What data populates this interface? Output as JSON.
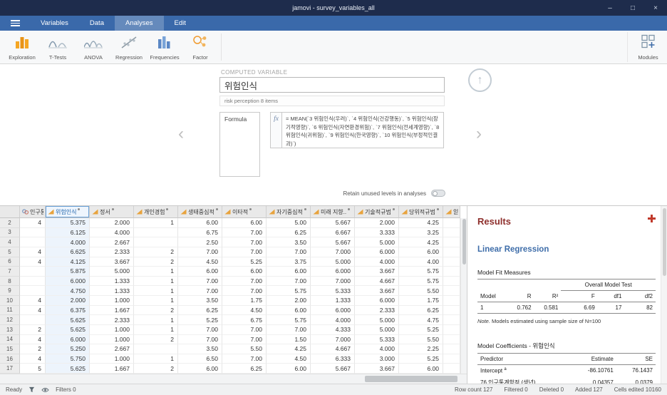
{
  "window": {
    "title": "jamovi - survey_variables_all"
  },
  "icons": {
    "minimize": "–",
    "maximize": "□",
    "close": "×",
    "chevron_left": "‹",
    "chevron_right": "›",
    "collapse_up": "↑"
  },
  "menu": {
    "tabs": [
      {
        "label": "Variables",
        "active": false
      },
      {
        "label": "Data",
        "active": false
      },
      {
        "label": "Analyses",
        "active": true
      },
      {
        "label": "Edit",
        "active": false
      }
    ]
  },
  "toolbar": {
    "items": [
      {
        "label": "Exploration"
      },
      {
        "label": "T-Tests"
      },
      {
        "label": "ANOVA"
      },
      {
        "label": "Regression"
      },
      {
        "label": "Frequencies"
      },
      {
        "label": "Factor"
      }
    ],
    "modules_label": "Modules"
  },
  "editor": {
    "panel_title": "COMPUTED VARIABLE",
    "name_value": "위험인식",
    "description": "risk perception 8  items",
    "formula_label": "Formula",
    "fx_label": "fx",
    "formula_text": "= MEAN(`3 위험인식(우려)`, `4 위험인식(건강행동)`, `5 위험인식(장기적영향)`, `6 위험인식(자연환경위험)`, `7 위험인식(전세계영향)`, `8 위험인식(귀위험)`, `9 위험인식(한국영향)`, `10 위험인식(부정적인결과)`)",
    "retain_label": "Retain unused levels in analyses",
    "retain_on": false
  },
  "table": {
    "selected_column_index": 1,
    "columns": [
      {
        "label": "인구통..",
        "icon": "nominal-variable-icon",
        "type": "nominal",
        "computed": false
      },
      {
        "label": "위험인식",
        "icon": "continuous-variable-icon",
        "type": "continuous",
        "computed": true
      },
      {
        "label": "정서",
        "icon": "continuous-variable-icon",
        "type": "continuous",
        "computed": true
      },
      {
        "label": "개인경험",
        "icon": "continuous-variable-icon",
        "type": "continuous",
        "computed": true
      },
      {
        "label": "생태중심적",
        "icon": "continuous-variable-icon",
        "type": "continuous",
        "computed": true
      },
      {
        "label": "이타적",
        "icon": "continuous-variable-icon",
        "type": "continuous",
        "computed": true
      },
      {
        "label": "자기중심적",
        "icon": "continuous-variable-icon",
        "type": "continuous",
        "computed": true
      },
      {
        "label": "미래 지향..",
        "icon": "continuous-variable-icon",
        "type": "continuous",
        "computed": true
      },
      {
        "label": "기술적규범",
        "icon": "continuous-variable-icon",
        "type": "continuous",
        "computed": true
      },
      {
        "label": "당위적규범",
        "icon": "continuous-variable-icon",
        "type": "continuous",
        "computed": true
      },
      {
        "label": "읻",
        "icon": "continuous-variable-icon",
        "type": "continuous",
        "computed": false
      }
    ],
    "rows": [
      {
        "num": "2",
        "cells": [
          "4",
          "5.375",
          "2.000",
          "1",
          "6.00",
          "6.00",
          "5.00",
          "5.667",
          "2.000",
          "4.25",
          ""
        ]
      },
      {
        "num": "3",
        "cells": [
          "",
          "6.125",
          "4.000",
          "",
          "6.75",
          "7.00",
          "6.25",
          "6.667",
          "3.333",
          "3.25",
          ""
        ]
      },
      {
        "num": "4",
        "cells": [
          "",
          "4.000",
          "2.667",
          "",
          "2.50",
          "7.00",
          "3.50",
          "5.667",
          "5.000",
          "4.25",
          ""
        ]
      },
      {
        "num": "5",
        "cells": [
          "4",
          "6.625",
          "2.333",
          "2",
          "7.00",
          "7.00",
          "7.00",
          "7.000",
          "6.000",
          "6.00",
          ""
        ]
      },
      {
        "num": "6",
        "cells": [
          "4",
          "4.125",
          "3.667",
          "2",
          "4.50",
          "5.25",
          "3.75",
          "5.000",
          "4.000",
          "4.00",
          ""
        ]
      },
      {
        "num": "7",
        "cells": [
          "",
          "5.875",
          "5.000",
          "1",
          "6.00",
          "6.00",
          "6.00",
          "6.000",
          "3.667",
          "5.75",
          ""
        ]
      },
      {
        "num": "8",
        "cells": [
          "",
          "6.000",
          "1.333",
          "1",
          "7.00",
          "7.00",
          "7.00",
          "7.000",
          "4.667",
          "5.75",
          ""
        ]
      },
      {
        "num": "9",
        "cells": [
          "",
          "4.750",
          "1.333",
          "1",
          "7.00",
          "7.00",
          "5.75",
          "5.333",
          "3.667",
          "5.50",
          ""
        ]
      },
      {
        "num": "10",
        "cells": [
          "4",
          "2.000",
          "1.000",
          "1",
          "3.50",
          "1.75",
          "2.00",
          "1.333",
          "6.000",
          "1.75",
          ""
        ]
      },
      {
        "num": "11",
        "cells": [
          "4",
          "6.375",
          "1.667",
          "2",
          "6.25",
          "4.50",
          "6.00",
          "6.000",
          "2.333",
          "6.25",
          ""
        ]
      },
      {
        "num": "12",
        "cells": [
          "",
          "5.625",
          "2.333",
          "1",
          "5.25",
          "6.75",
          "5.75",
          "4.000",
          "5.000",
          "4.75",
          ""
        ]
      },
      {
        "num": "13",
        "cells": [
          "2",
          "5.625",
          "1.000",
          "1",
          "7.00",
          "7.00",
          "7.00",
          "4.333",
          "5.000",
          "5.25",
          ""
        ]
      },
      {
        "num": "14",
        "cells": [
          "4",
          "6.000",
          "1.000",
          "2",
          "7.00",
          "7.00",
          "1.50",
          "7.000",
          "5.333",
          "5.50",
          ""
        ]
      },
      {
        "num": "15",
        "cells": [
          "2",
          "5.250",
          "2.667",
          "",
          "3.50",
          "5.50",
          "4.25",
          "4.667",
          "4.000",
          "2.25",
          ""
        ]
      },
      {
        "num": "16",
        "cells": [
          "4",
          "5.750",
          "1.000",
          "1",
          "6.50",
          "7.00",
          "4.50",
          "6.333",
          "3.000",
          "5.25",
          ""
        ]
      },
      {
        "num": "17",
        "cells": [
          "5",
          "5.625",
          "1.667",
          "2",
          "6.00",
          "6.25",
          "6.00",
          "5.667",
          "3.667",
          "6.00",
          ""
        ]
      }
    ]
  },
  "results": {
    "title": "Results",
    "analysis_title": "Linear Regression",
    "fit": {
      "caption": "Model Fit Measures",
      "span_header": "Overall Model Test",
      "col_headers": [
        "Model",
        "R",
        "R²",
        "F",
        "df1",
        "df2"
      ],
      "row": [
        "1",
        "0.762",
        "0.581",
        "6.69",
        "17",
        "82"
      ],
      "note_prefix": "Note.",
      "note": " Models estimated using sample size of N=100"
    },
    "coef": {
      "caption": "Model Coefficients - 위험인식",
      "col_headers": [
        "Predictor",
        "Estimate",
        "SE"
      ],
      "rows": [
        {
          "predictor": "Intercept ",
          "sup": "a",
          "estimate": "-86.10761",
          "se": "76.1437"
        },
        {
          "predictor": "76 인구통계학적 (생년)",
          "sup": "",
          "estimate": "0.04357",
          "se": "0.0379"
        }
      ]
    }
  },
  "statusbar": {
    "ready": "Ready",
    "filters": "Filters 0",
    "right_items": [
      "Row count 127",
      "Filtered 0",
      "Deleted 0",
      "Added 127",
      "Cells edited 10160"
    ]
  }
}
